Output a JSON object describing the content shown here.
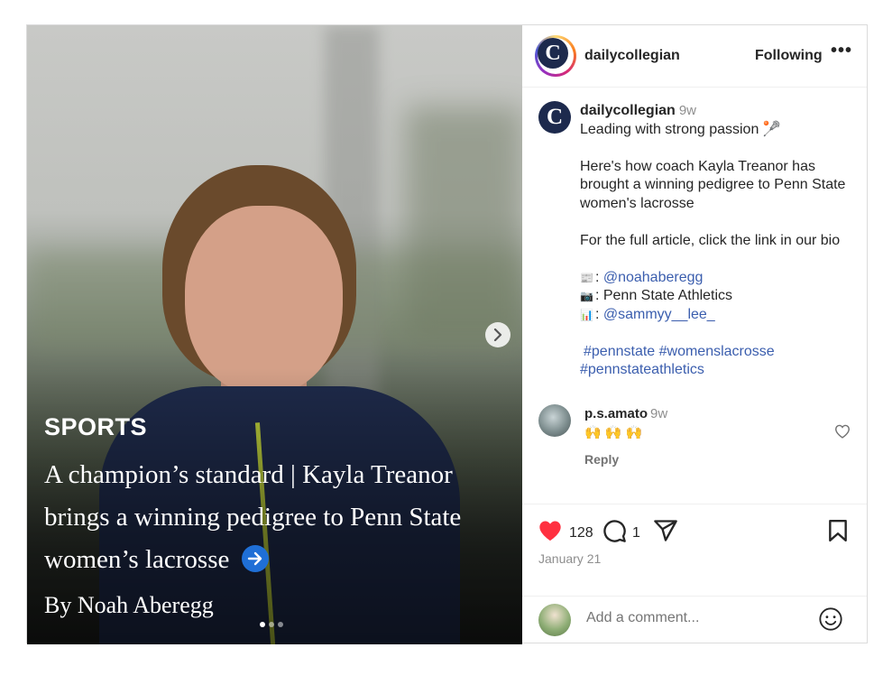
{
  "media": {
    "section": "SPORTS",
    "headline": "A champion’s standard | Kayla Treanor brings a winning pedigree to Penn State women’s lacrosse",
    "byline": "By Noah Aberegg",
    "slide_count": 3,
    "active_slide": 1
  },
  "header": {
    "logo_letter": "C",
    "username": "dailycollegian",
    "follow_label": "Following",
    "more_label": "•••"
  },
  "caption": {
    "logo_letter": "C",
    "username": "dailycollegian",
    "time": "9w",
    "line1": "Leading with strong passion 🥍",
    "para2": "Here's how coach Kayla Treanor has brought a winning pedigree to Penn State women's lacrosse",
    "para3": "For the full article, click the link in our bio",
    "credit1_icon": "📰",
    "credit1_handle": "@noahaberegg",
    "credit2_icon": "📷",
    "credit2_text": "Penn State Athletics",
    "credit3_icon": "📊",
    "credit3_handle": "@sammyy__lee_",
    "hashtags_line1": "#pennstate #womenslacrosse",
    "hashtags_line2": "#pennstateathletics"
  },
  "comment": {
    "username": "p.s.amato",
    "time": "9w",
    "text": "🙌 🙌 🙌",
    "reply_label": "Reply"
  },
  "actions": {
    "likes": "128",
    "comments": "1",
    "date": "January 21"
  },
  "add_comment": {
    "placeholder": "Add a comment..."
  },
  "colors": {
    "like_red": "#ff3040",
    "link_blue": "#3b5eae",
    "logo_navy": "#1d2a4d"
  }
}
